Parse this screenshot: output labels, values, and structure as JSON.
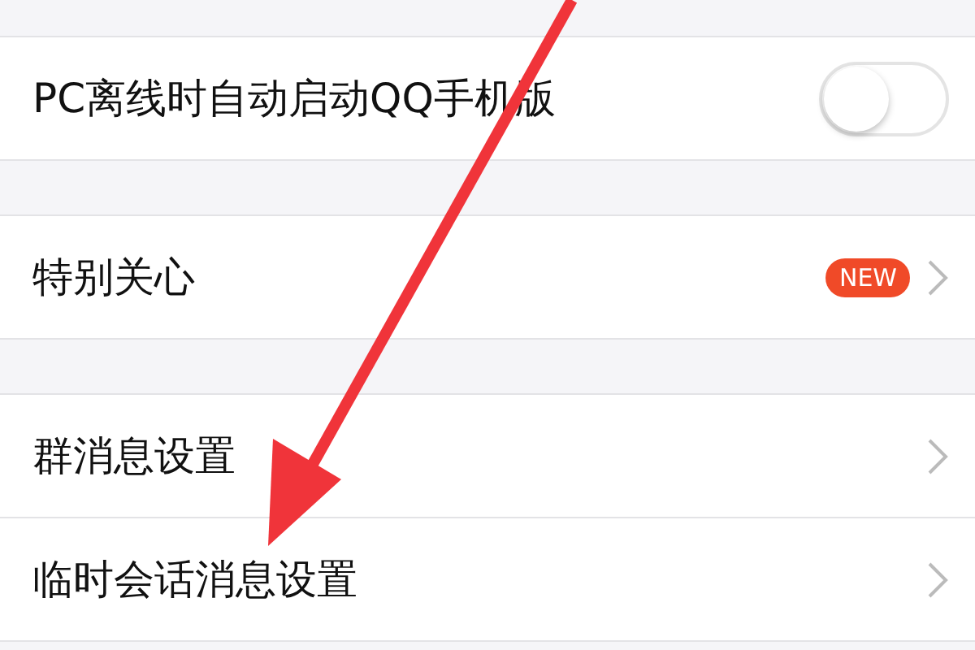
{
  "sections": [
    {
      "items": [
        {
          "kind": "toggle",
          "label": "PC离线时自动启动QQ手机版",
          "on": false
        }
      ]
    },
    {
      "items": [
        {
          "kind": "link",
          "label": "特别关心",
          "badge": "NEW"
        }
      ]
    },
    {
      "items": [
        {
          "kind": "link",
          "label": "群消息设置"
        },
        {
          "kind": "link",
          "label": "临时会话消息设置"
        }
      ]
    }
  ]
}
